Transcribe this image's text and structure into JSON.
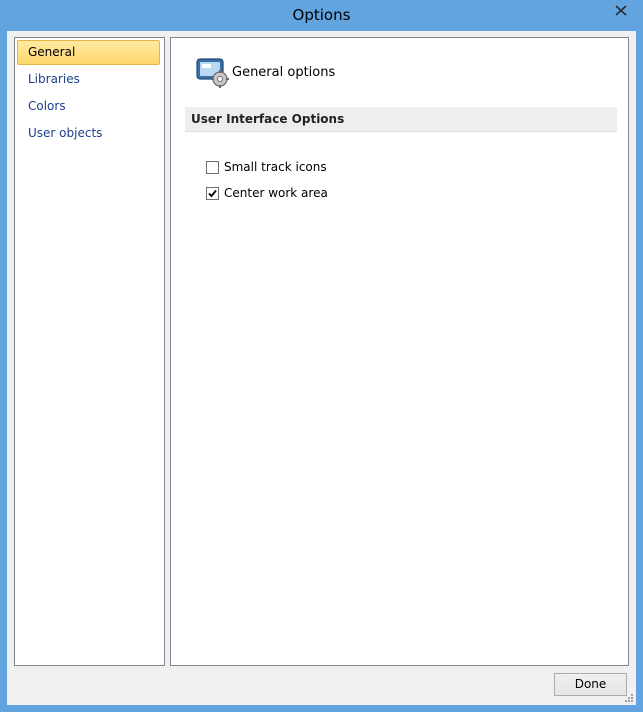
{
  "window": {
    "title": "Options"
  },
  "sidebar": {
    "items": [
      {
        "label": "General",
        "selected": true
      },
      {
        "label": "Libraries",
        "selected": false
      },
      {
        "label": "Colors",
        "selected": false
      },
      {
        "label": "User objects",
        "selected": false
      }
    ]
  },
  "panel": {
    "title": "General options",
    "section_title": "User Interface Options",
    "options": [
      {
        "label": "Small track icons",
        "checked": false
      },
      {
        "label": "Center work area",
        "checked": true
      }
    ]
  },
  "footer": {
    "done_label": "Done"
  },
  "colors": {
    "titlebar": "#62a4e0",
    "selected_item": "#ffd76e",
    "link_text": "#1e3f8a"
  }
}
